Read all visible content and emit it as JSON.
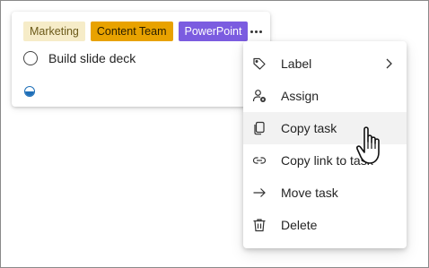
{
  "card": {
    "tags": [
      {
        "label": "Marketing",
        "color": "#f6ecc8"
      },
      {
        "label": "Content Team",
        "color": "#e8a200"
      },
      {
        "label": "PowerPoint",
        "color": "#7b5ce0"
      }
    ],
    "task_title": "Build slide deck",
    "progress_icon": "half-filled-circle-icon",
    "progress_fraction": 0.5
  },
  "menu": {
    "items": [
      {
        "label": "Label",
        "icon": "tag-icon",
        "has_submenu": true
      },
      {
        "label": "Assign",
        "icon": "assign-person-icon"
      },
      {
        "label": "Copy task",
        "icon": "copy-icon",
        "hovered": true
      },
      {
        "label": "Copy link to task",
        "icon": "link-icon"
      },
      {
        "label": "Move task",
        "icon": "arrow-right-icon"
      },
      {
        "label": "Delete",
        "icon": "trash-icon"
      }
    ]
  }
}
